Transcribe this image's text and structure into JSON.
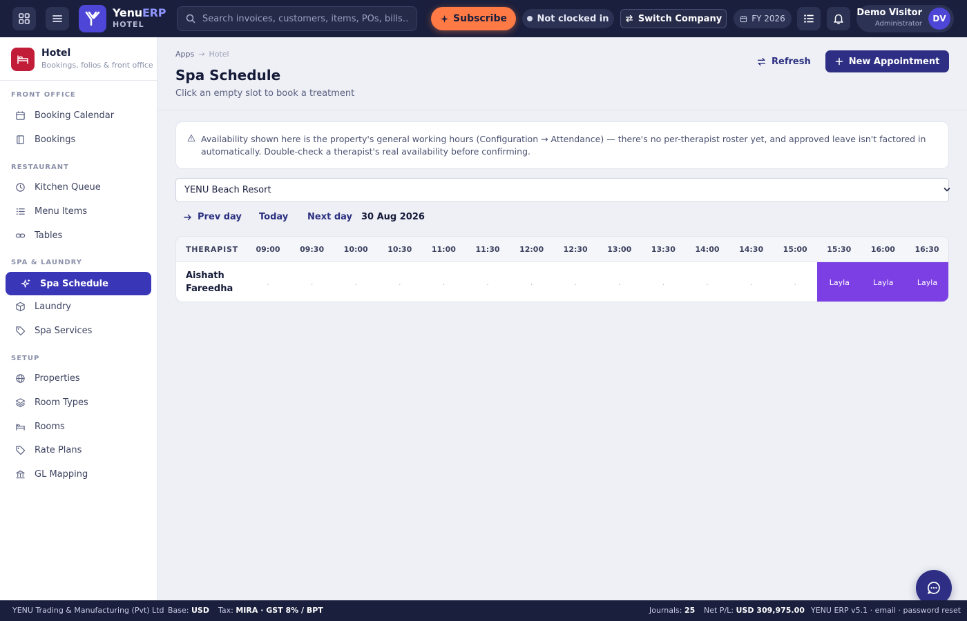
{
  "brand": {
    "name_main": "Yenu",
    "name_accent": "ERP",
    "module": "HOTEL"
  },
  "search": {
    "placeholder": "Search invoices, customers, items, POs, bills…"
  },
  "topbar": {
    "subscribe_label": "Subscribe",
    "clock_status": "Not clocked in",
    "switch_company_label": "Switch Company",
    "fiscal_year": "FY 2026",
    "user_name": "Demo Visitor",
    "user_role": "Administrator",
    "user_initials": "DV"
  },
  "sidebar": {
    "app_title": "Hotel",
    "app_subtitle": "Bookings, folios & front office",
    "sections": {
      "front_office": "FRONT OFFICE",
      "restaurant": "RESTAURANT",
      "spa_laundry": "SPA & LAUNDRY",
      "setup": "SETUP"
    },
    "items": {
      "booking_calendar": "Booking Calendar",
      "bookings": "Bookings",
      "kitchen_queue": "Kitchen Queue",
      "menu_items": "Menu Items",
      "tables": "Tables",
      "spa_schedule": "Spa Schedule",
      "laundry": "Laundry",
      "spa_services": "Spa Services",
      "properties": "Properties",
      "room_types": "Room Types",
      "rooms": "Rooms",
      "rate_plans": "Rate Plans",
      "gl_mapping": "GL Mapping"
    }
  },
  "page": {
    "breadcrumb": [
      "Apps",
      "Hotel"
    ],
    "title": "Spa Schedule",
    "subtitle": "Click an empty slot to book a treatment",
    "refresh_label": "Refresh",
    "new_appointment_label": "New Appointment",
    "notice": "Availability shown here is the property's general working hours (Configuration → Attendance) — there's no per-therapist roster yet, and approved leave isn't factored in automatically. Double-check a therapist's real availability before confirming.",
    "property_select": {
      "selected": "YENU Beach Resort"
    },
    "day_nav": {
      "prev": "Prev day",
      "today": "Today",
      "next": "Next day",
      "date": "30 Aug 2026"
    }
  },
  "schedule": {
    "header_label": "THERAPIST",
    "times": [
      "09:00",
      "09:30",
      "10:00",
      "10:30",
      "11:00",
      "11:30",
      "12:00",
      "12:30",
      "13:00",
      "13:30",
      "14:00",
      "14:30",
      "15:00",
      "15:30",
      "16:00",
      "16:30"
    ],
    "rows": [
      {
        "therapist": "Aishath Fareedha",
        "slots": [
          ".",
          ".",
          ".",
          ".",
          ".",
          ".",
          ".",
          ".",
          ".",
          ".",
          ".",
          ".",
          ".",
          "Layla",
          "Layla",
          "Layla"
        ],
        "booked": [
          false,
          false,
          false,
          false,
          false,
          false,
          false,
          false,
          false,
          false,
          false,
          false,
          false,
          true,
          true,
          true
        ]
      }
    ],
    "booked_color": "#7b3fe4"
  },
  "footer": {
    "company": "YENU Trading & Manufacturing (Pvt) Ltd",
    "base_label": "Base:",
    "base_value": "USD",
    "tax_label": "Tax:",
    "tax_value": "MIRA · GST 8% / BPT",
    "journals_label": "Journals:",
    "journals_value": "25",
    "netpl_label": "Net P/L:",
    "netpl_value": "USD 309,975.00",
    "version": "YENU ERP v5.1 · email · password reset"
  }
}
